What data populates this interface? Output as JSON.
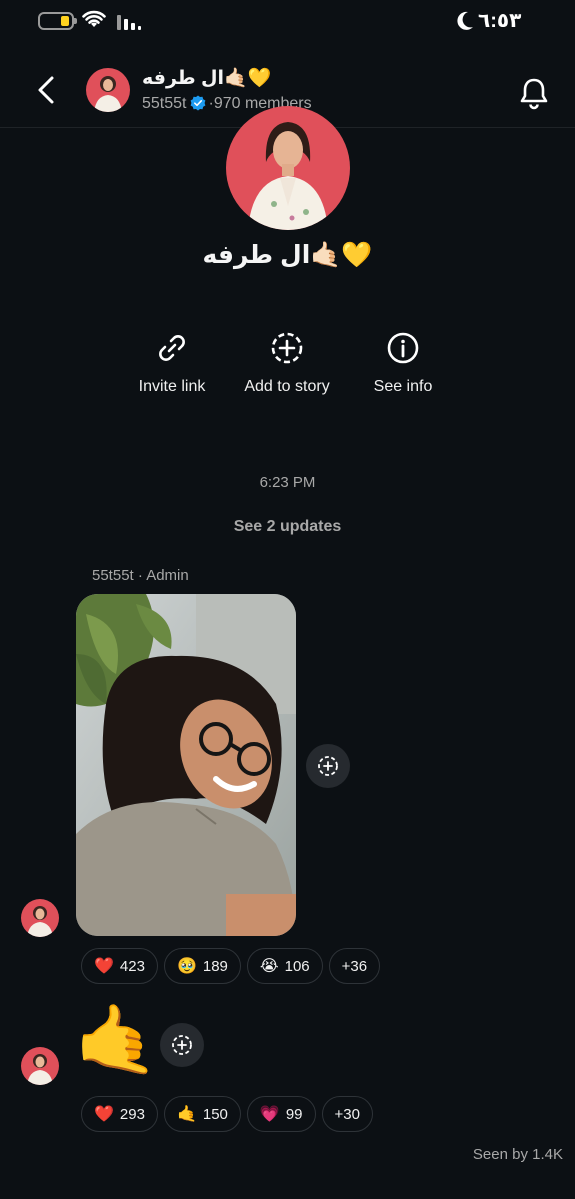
{
  "status_bar": {
    "time": "٦:٥٣",
    "battery_color": "#ffd21f",
    "icons": [
      "battery-icon",
      "wifi-icon",
      "signal-icon",
      "moon-icon"
    ]
  },
  "header": {
    "title": "ال طرفه🤙🏻💛",
    "handle": "55t55t",
    "members": "·970 members",
    "icons": [
      "back-chevron-icon",
      "verified-badge-icon",
      "bell-icon"
    ]
  },
  "channel": {
    "name": "ال طرفه🤙🏻💛"
  },
  "actions": {
    "invite_label": "Invite link",
    "story_label": "Add to story",
    "info_label": "See info"
  },
  "timeline": {
    "timestamp": "6:23 PM",
    "see_updates": "See 2 updates"
  },
  "messages": [
    {
      "sender": "55t55t · Admin",
      "type": "photo",
      "reactions": [
        {
          "emoji": "❤️",
          "count": "423"
        },
        {
          "emoji": "🥹",
          "count": "189"
        },
        {
          "emoji": "😭",
          "count": "106"
        },
        {
          "emoji": "",
          "count": "+36"
        }
      ]
    },
    {
      "type": "emoji",
      "content": "🤙",
      "reactions": [
        {
          "emoji": "❤️",
          "count": "293"
        },
        {
          "emoji": "🤙",
          "count": "150"
        },
        {
          "emoji": "💗",
          "count": "99"
        },
        {
          "emoji": "",
          "count": "+30"
        }
      ]
    }
  ],
  "footer": {
    "seen": "Seen by 1.4K"
  },
  "colors": {
    "background": "#0c1014",
    "accent_verified": "#1d9bf0",
    "muted_text": "#a8a8a8",
    "avatar_bg": "#e0505a"
  }
}
